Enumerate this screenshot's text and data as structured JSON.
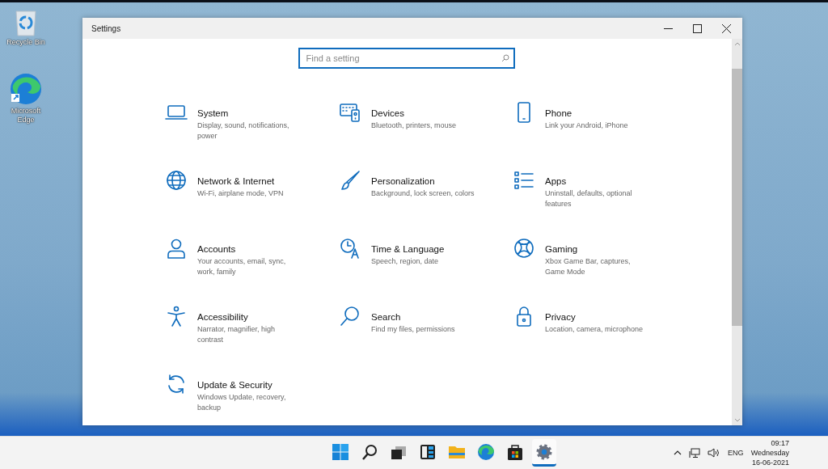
{
  "desktop_icons": [
    {
      "kind": "recycle",
      "label": "Recycle Bin"
    },
    {
      "kind": "edge",
      "label": "Microsoft Edge"
    }
  ],
  "window": {
    "title": "Settings"
  },
  "search": {
    "placeholder": "Find a setting"
  },
  "categories": [
    {
      "kind": "system",
      "name": "System",
      "description": "Display, sound, notifications, power"
    },
    {
      "kind": "devices",
      "name": "Devices",
      "description": "Bluetooth, printers, mouse"
    },
    {
      "kind": "phone",
      "name": "Phone",
      "description": "Link your Android, iPhone"
    },
    {
      "kind": "network",
      "name": "Network & Internet",
      "description": "Wi-Fi, airplane mode, VPN"
    },
    {
      "kind": "personalization",
      "name": "Personalization",
      "description": "Background, lock screen, colors"
    },
    {
      "kind": "apps",
      "name": "Apps",
      "description": "Uninstall, defaults, optional features"
    },
    {
      "kind": "accounts",
      "name": "Accounts",
      "description": "Your accounts, email, sync, work, family"
    },
    {
      "kind": "time",
      "name": "Time & Language",
      "description": "Speech, region, date"
    },
    {
      "kind": "gaming",
      "name": "Gaming",
      "description": "Xbox Game Bar, captures, Game Mode"
    },
    {
      "kind": "accessibility",
      "name": "Accessibility",
      "description": "Narrator, magnifier, high contrast"
    },
    {
      "kind": "search",
      "name": "Search",
      "description": "Find my files, permissions"
    },
    {
      "kind": "privacy",
      "name": "Privacy",
      "description": "Location, camera, microphone"
    },
    {
      "kind": "update",
      "name": "Update & Security",
      "description": "Windows Update, recovery, backup"
    }
  ],
  "taskbar": {
    "apps": [
      {
        "kind": "start",
        "selected": false
      },
      {
        "kind": "search",
        "selected": false
      },
      {
        "kind": "taskview",
        "selected": false
      },
      {
        "kind": "widgets",
        "selected": false
      },
      {
        "kind": "explorer",
        "selected": false
      },
      {
        "kind": "edge",
        "selected": false
      },
      {
        "kind": "store",
        "selected": false
      },
      {
        "kind": "settings",
        "selected": true
      }
    ],
    "tray": {
      "language": "ENG",
      "time": "09:17",
      "day": "Wednesday",
      "date": "16-06-2021"
    }
  }
}
